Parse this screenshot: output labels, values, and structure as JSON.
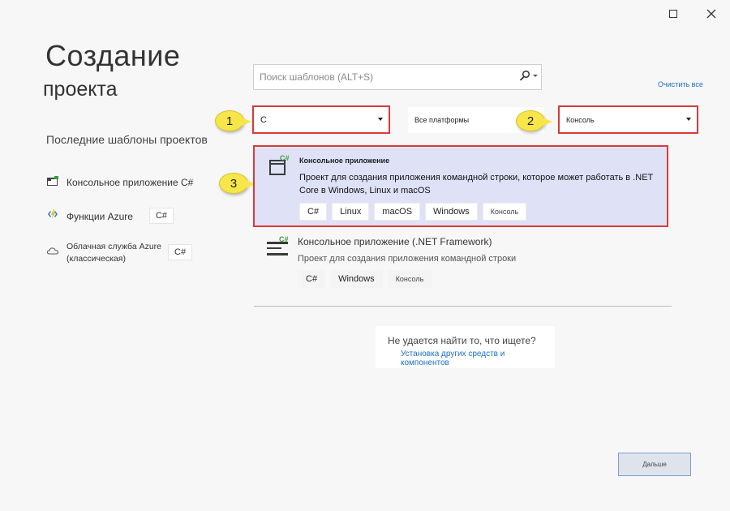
{
  "window": {
    "minimize_label": "—",
    "maximize_label": "☐",
    "close_label": "✕"
  },
  "page": {
    "title_line1": "Создание",
    "title_line2": "проекта"
  },
  "recent": {
    "header": "Последние шаблоны проектов",
    "items": [
      {
        "label": "Консольное приложение C#",
        "lang": "",
        "icon": "console-app-icon"
      },
      {
        "label": "Функции Azure",
        "lang": "C#",
        "icon": "azure-functions-icon"
      },
      {
        "label_line1": "Облачная служба Azure",
        "label_line2": "(классическая)",
        "lang": "C#",
        "icon": "cloud-service-icon"
      }
    ]
  },
  "search": {
    "placeholder": "Поиск шаблонов (ALT+S)",
    "clear_all": "Очистить все"
  },
  "filters": {
    "language": "C",
    "platform": "Все платформы",
    "project_type": "Консоль"
  },
  "callouts": [
    "1",
    "2",
    "3"
  ],
  "templates": [
    {
      "title": "Консольное приложение",
      "badge": "C#",
      "description": "Проект для создания приложения командной строки, которое может работать в .NET Core в Windows, Linux и macOS",
      "tags": [
        "C#",
        "Linux",
        "macOS",
        "Windows",
        "Консоль"
      ]
    },
    {
      "title": "Консольное приложение (.NET Framework)",
      "badge": "C#",
      "description": "Проект для создания приложения командной строки",
      "tags": [
        "C#",
        "Windows",
        "Консоль"
      ]
    }
  ],
  "not_found": {
    "question": "Не удается найти то, что ищете?",
    "link": "Установка других средств и компонентов"
  },
  "footer": {
    "next_label": "Дальше"
  },
  "colors": {
    "accent": "#1a6fc4",
    "highlight": "#dfe1f7",
    "callout": "#f7e64a",
    "annotation_border": "#d93a3a"
  }
}
